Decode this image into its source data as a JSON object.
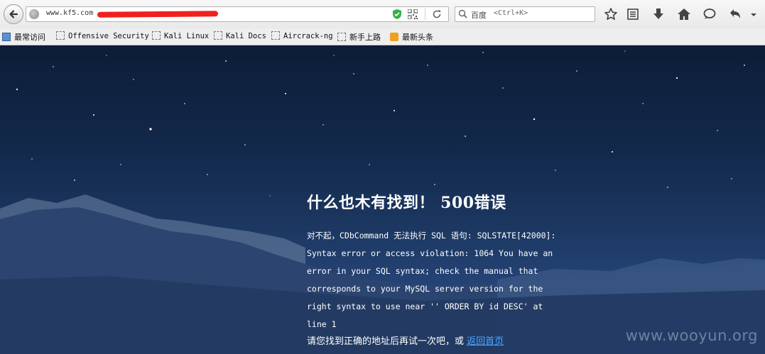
{
  "browser": {
    "url_prefix": "www.kf5.com",
    "search_engine": "百度",
    "search_placeholder": "<Ctrl+K>"
  },
  "bookmarks": [
    {
      "label": "最常访问",
      "icon": "most-visited-icon"
    },
    {
      "label": "Offensive Security",
      "icon": "bookmark-placeholder-icon"
    },
    {
      "label": "Kali Linux",
      "icon": "bookmark-placeholder-icon"
    },
    {
      "label": "Kali Docs",
      "icon": "bookmark-placeholder-icon"
    },
    {
      "label": "Aircrack-ng",
      "icon": "bookmark-placeholder-icon"
    },
    {
      "label": "新手上路",
      "icon": "bookmark-placeholder-icon"
    },
    {
      "label": "最新头条",
      "icon": "rss-icon"
    }
  ],
  "toolbar_icons": [
    "bookmark-star-icon",
    "reading-list-icon",
    "downloads-icon",
    "home-icon",
    "chat-icon",
    "undo-icon",
    "menu-chevron-icon"
  ],
  "error": {
    "title": "什么也木有找到！ 500错误",
    "message": "对不起，CDbCommand 无法执行 SQL 语句: SQLSTATE[42000]: Syntax error or access violation: 1064 You have an error in your SQL syntax; check the manual that corresponds to your MySQL server version for the right syntax to use near '' ORDER BY id DESC' at line 1",
    "retry_text": "请您找到正确的地址后再试一次吧，或",
    "home_link": "返回首页"
  },
  "watermark": "www.wooyun.org",
  "colors": {
    "link": "#4aa7ff",
    "redaction": "#f0201e",
    "background_top": "#0c1d37",
    "background_bottom": "#3a5a8e"
  }
}
